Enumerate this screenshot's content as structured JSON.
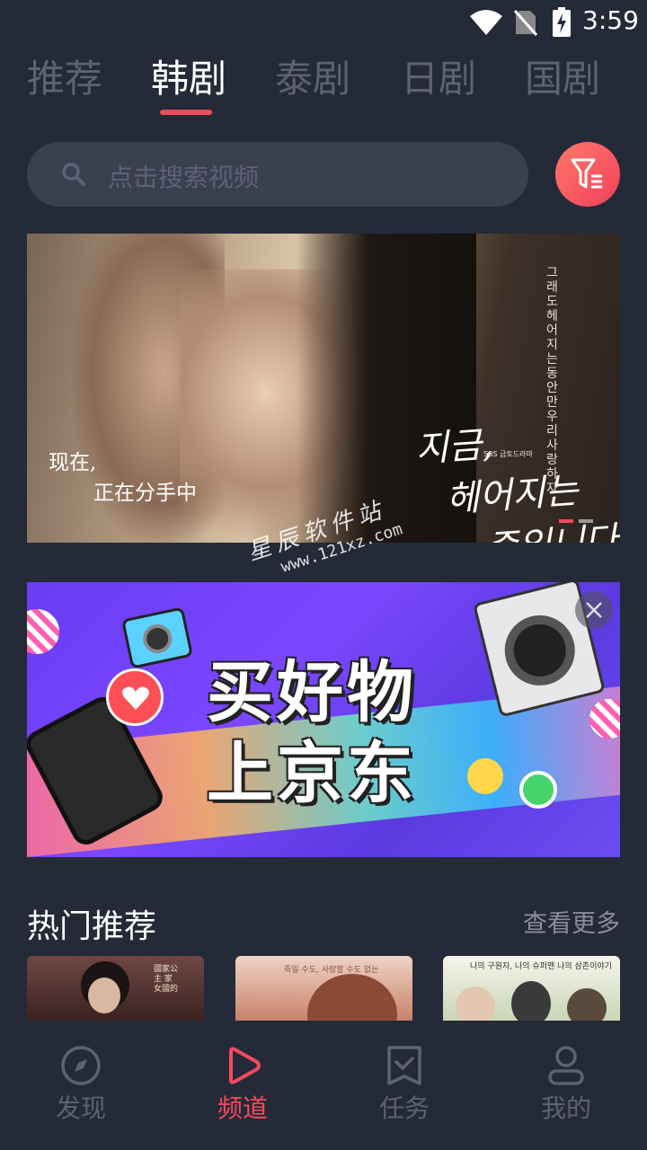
{
  "status_bar": {
    "time": "3:59"
  },
  "tabs": [
    {
      "label": "推荐"
    },
    {
      "label": "韩剧"
    },
    {
      "label": "泰剧"
    },
    {
      "label": "日剧"
    },
    {
      "label": "国剧"
    }
  ],
  "active_tab": "韩剧",
  "search": {
    "placeholder": "点击搜索视频"
  },
  "banner": {
    "caption_line1": "现在,",
    "caption_line2": "正在分手中",
    "korean_vertical": "그래도 헤어지는 동안만 우리 사랑하자",
    "korean_title_1": "지금,",
    "korean_title_2": "헤어지는",
    "korean_title_3": "중입니다",
    "network": "SBS 금토드라마",
    "active_slide": 1,
    "total_slides": 2
  },
  "watermark": {
    "line1": "星辰软件站",
    "line2": "www.121xz.com"
  },
  "ad": {
    "line1": "买好物",
    "line2": "上京东"
  },
  "hot": {
    "title": "热门推荐",
    "more": "查看更多",
    "thumbs": [
      {
        "overlay": "國家公主 家女國的"
      },
      {
        "overlay": "죽일 수도, 사랑할 수도 없는"
      },
      {
        "overlay": "나의 구원자, 나의 슈퍼맨 나의 삼촌이야기"
      }
    ]
  },
  "bottom_nav": [
    {
      "label": "发现",
      "icon": "compass-icon"
    },
    {
      "label": "频道",
      "icon": "play-icon"
    },
    {
      "label": "任务",
      "icon": "task-icon"
    },
    {
      "label": "我的",
      "icon": "user-icon"
    }
  ],
  "colors": {
    "accent": "#f24b5d",
    "background": "#252a38",
    "inactive": "#5d6274"
  }
}
